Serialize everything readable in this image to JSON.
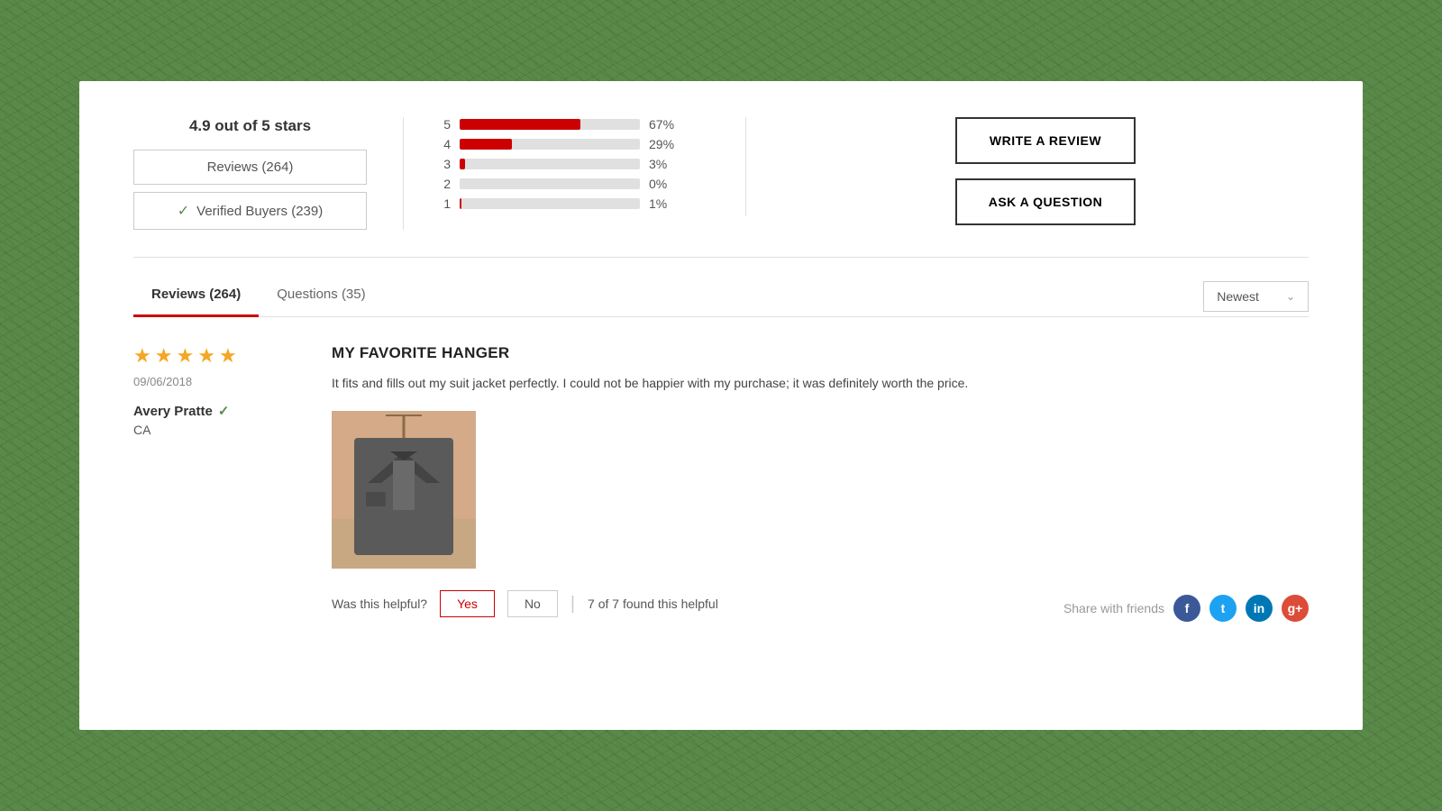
{
  "background": {
    "color": "#5a8a4a"
  },
  "rating_summary": {
    "title": "4.9 out of 5 stars",
    "reviews_label": "Reviews (264)",
    "verified_label": "Verified Buyers (239)"
  },
  "bars": [
    {
      "stars": "5",
      "pct": 67,
      "label": "67%"
    },
    {
      "stars": "4",
      "pct": 29,
      "label": "29%"
    },
    {
      "stars": "3",
      "pct": 3,
      "label": "3%"
    },
    {
      "stars": "2",
      "pct": 0,
      "label": "0%"
    },
    {
      "stars": "1",
      "pct": 1,
      "label": "1%"
    }
  ],
  "actions": {
    "write_review": "WRITE A REVIEW",
    "ask_question": "ASK A QUESTION"
  },
  "tabs": {
    "reviews": "Reviews (264)",
    "questions": "Questions (35)"
  },
  "sort": {
    "label": "Newest"
  },
  "review": {
    "stars": 5,
    "date": "09/06/2018",
    "author": "Avery Pratte",
    "location": "CA",
    "title": "MY FAVORITE HANGER",
    "body": "It fits and fills out my suit jacket perfectly. I could not be happier with my purchase; it was definitely worth the price.",
    "helpful_label": "Was this helpful?",
    "yes_label": "Yes",
    "no_label": "No",
    "helpful_count": "7 of 7 found this helpful",
    "share_label": "Share with friends"
  }
}
